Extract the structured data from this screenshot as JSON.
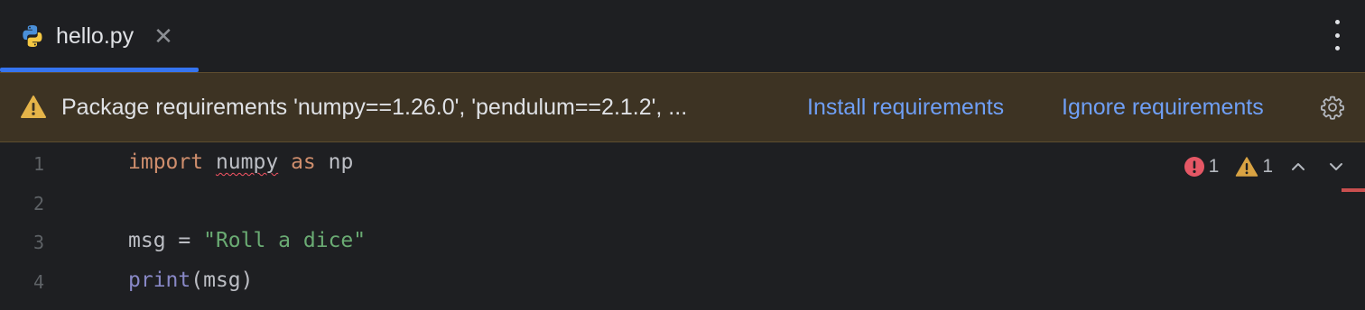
{
  "tab": {
    "filename": "hello.py",
    "close_glyph": "✕",
    "icon": "python-file-icon"
  },
  "banner": {
    "message": "Package requirements 'numpy==1.26.0', 'pendulum==2.1.2', ...",
    "install_label": "Install requirements",
    "ignore_label": "Ignore requirements",
    "icons": [
      "warning-icon",
      "gear-icon"
    ]
  },
  "editor": {
    "line_numbers": [
      "1",
      "2",
      "3",
      "4"
    ],
    "code": {
      "line1": {
        "kw_import": "import",
        "module": "numpy",
        "kw_as": "as",
        "alias": "np"
      },
      "line3": {
        "var": "msg",
        "op": " = ",
        "string": "\"Roll a dice\""
      },
      "line4": {
        "func": "print",
        "args": "(msg)"
      }
    },
    "inspections": {
      "errors": "1",
      "warnings": "1"
    }
  },
  "colors": {
    "accent": "#3574f0",
    "banner_bg": "#3d3323",
    "link": "#6f9ff5",
    "keyword": "#cf8e6d",
    "string": "#6aab73",
    "builtin": "#8888c6",
    "error": "#e55765",
    "warning": "#d9a343"
  }
}
